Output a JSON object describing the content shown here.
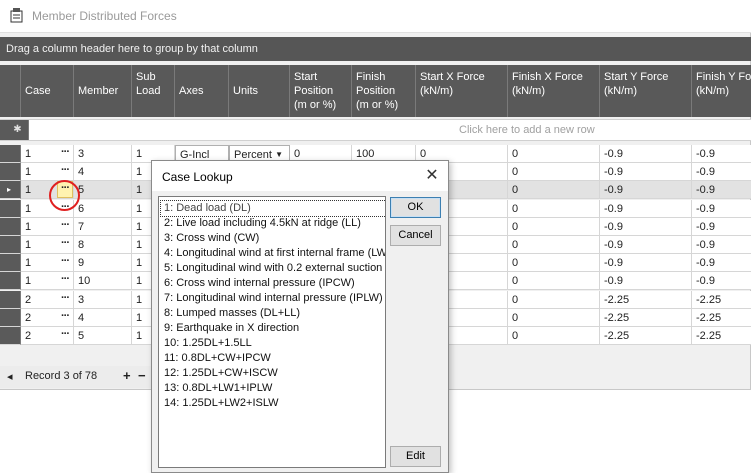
{
  "window": {
    "title": "Member Distributed Forces"
  },
  "grid": {
    "group_hint": "Drag a column header here to group by that column",
    "new_row_hint": "Click here to add a new row",
    "columns": [
      "Case",
      "Member",
      "Sub\nLoad",
      "Axes",
      "Units",
      "Start\nPosition\n(m or %)",
      "Finish\nPosition\n(m or %)",
      "Start X Force\n(kN/m)",
      "Finish X Force\n(kN/m)",
      "Start Y Force\n(kN/m)",
      "Finish Y Force\n(kN/m)"
    ],
    "rows": [
      [
        "1",
        "3",
        "1",
        "G-Incl",
        "Percent",
        "0",
        "100",
        "0",
        "0",
        "-0.9",
        "-0.9"
      ],
      [
        "1",
        "4",
        "1",
        "",
        "",
        "",
        "",
        "",
        "0",
        "-0.9",
        "-0.9"
      ],
      [
        "1",
        "5",
        "1",
        "",
        "",
        "",
        "",
        "",
        "0",
        "-0.9",
        "-0.9"
      ],
      [
        "1",
        "6",
        "1",
        "",
        "",
        "",
        "",
        "",
        "0",
        "-0.9",
        "-0.9"
      ],
      [
        "1",
        "7",
        "1",
        "",
        "",
        "",
        "",
        "",
        "0",
        "-0.9",
        "-0.9"
      ],
      [
        "1",
        "8",
        "1",
        "",
        "",
        "",
        "",
        "",
        "0",
        "-0.9",
        "-0.9"
      ],
      [
        "1",
        "9",
        "1",
        "",
        "",
        "",
        "",
        "",
        "0",
        "-0.9",
        "-0.9"
      ],
      [
        "1",
        "10",
        "1",
        "",
        "",
        "",
        "",
        "",
        "0",
        "-0.9",
        "-0.9"
      ],
      [
        "2",
        "3",
        "1",
        "",
        "",
        "",
        "",
        "",
        "0",
        "-2.25",
        "-2.25"
      ],
      [
        "2",
        "4",
        "1",
        "",
        "",
        "",
        "",
        "",
        "0",
        "-2.25",
        "-2.25"
      ],
      [
        "2",
        "5",
        "1",
        "",
        "",
        "",
        "",
        "",
        "0",
        "-2.25",
        "-2.25"
      ]
    ],
    "selected_row_index": 2,
    "row_indicator": "▸",
    "new_row_indicator": "✱",
    "ellipsis": "···"
  },
  "navigator": {
    "record_text": "Record 3 of 78",
    "first": "◂",
    "add": "+",
    "remove": "−"
  },
  "dialog": {
    "title": "Case Lookup",
    "close_glyph": "✕",
    "ok_label": "OK",
    "cancel_label": "Cancel",
    "edit_label": "Edit",
    "items": [
      "1: Dead load (DL)",
      "2: Live load including 4.5kN at ridge (LL)",
      "3: Cross wind (CW)",
      "4: Longitudinal wind at first internal frame (LW",
      "5: Longitudinal wind with 0.2 external suction",
      "6: Cross wind internal pressure (IPCW)",
      "7: Longitudinal wind internal pressure (IPLW)",
      "8: Lumped masses (DL+LL)",
      "9: Earthquake in X direction",
      "10: 1.25DL+1.5LL",
      "11: 0.8DL+CW+IPCW",
      "12: 1.25DL+CW+ISCW",
      "13: 0.8DL+LW1+IPLW",
      "14: 1.25DL+LW2+ISLW"
    ],
    "selected_index": 0
  },
  "colors": {
    "header_bg": "#595959",
    "highlight_circle": "#e02020",
    "ellipsis_highlight": "#fff3b0"
  }
}
